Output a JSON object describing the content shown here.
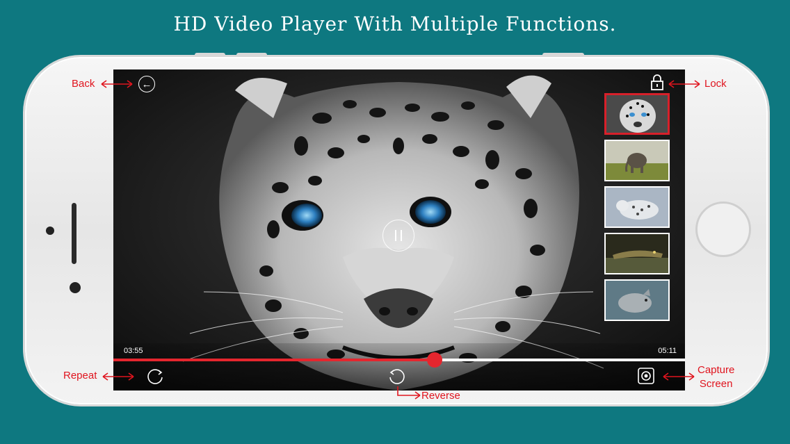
{
  "headline": "HD Video Player With Multiple Functions.",
  "player": {
    "current_time": "03:55",
    "duration": "05:11",
    "progress": 0.562,
    "selected_thumbnail": 0,
    "thumbnails": [
      {
        "subject": "snow leopard"
      },
      {
        "subject": "elephant"
      },
      {
        "subject": "snow leopard on snow"
      },
      {
        "subject": "crocodile"
      },
      {
        "subject": "wolf"
      }
    ]
  },
  "annotations": {
    "back": "Back",
    "lock": "Lock",
    "repeat": "Repeat",
    "reverse": "Reverse",
    "capture_line1": "Capture",
    "capture_line2": "Screen"
  },
  "colors": {
    "background": "#0e7880",
    "accent": "#e5262e",
    "annotation": "#e0141e"
  },
  "icons": [
    "back-arrow-icon",
    "lock-icon",
    "pause-icon",
    "repeat-icon",
    "reverse-icon",
    "camera-icon"
  ]
}
